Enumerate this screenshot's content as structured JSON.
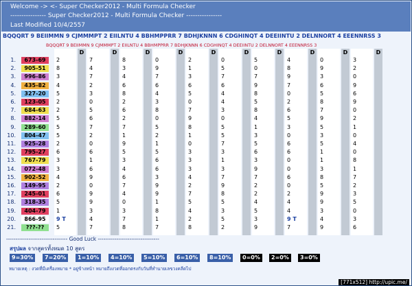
{
  "header": {
    "line1": "Welcome -> <- Super Checker2012 - Multi Formula Checker",
    "line2": "---------------- Super Checker2012 - Multi Formula Checker ----------------",
    "line3": "Last Modified 10/4/2557"
  },
  "formula_line": "BQQQRT 9 BEIIMMN 9 CJMMMPT 2 EIILNTU 4 BBHMPPRR 7 BDHJKNNN 6 CDGHINQT 4 DEEIINTU 2 DELNNORT 4 EEENNRSS 3",
  "formula_line_small": "BQQQRT 9 BEIIMMN 9 CJMMMPT 2 EIILNTU 4 BBHMPPRR 7 BDHJKNNN 6 CDGHINQT 4 DEEIINTU 2 DELNNORT 4 EEENNRSS 3",
  "d_label": "D",
  "rows": [
    {
      "n": "1.",
      "r": "673-69",
      "c": "#e04060",
      "v": [
        "2",
        "7",
        "8",
        "0",
        "2",
        "0",
        "5",
        "4",
        "0",
        "3"
      ]
    },
    {
      "n": "2.",
      "r": "905-51",
      "c": "#f0e050",
      "v": [
        "8",
        "4",
        "3",
        "9",
        "1",
        "5",
        "0",
        "8",
        "9",
        "2"
      ]
    },
    {
      "n": "3.",
      "r": "996-86",
      "c": "#d080d0",
      "v": [
        "3",
        "7",
        "4",
        "7",
        "3",
        "7",
        "7",
        "9",
        "3",
        "0"
      ]
    },
    {
      "n": "4.",
      "r": "435-82",
      "c": "#f0b040",
      "v": [
        "4",
        "2",
        "6",
        "6",
        "6",
        "6",
        "9",
        "7",
        "6",
        "9"
      ]
    },
    {
      "n": "5.",
      "r": "327-20",
      "c": "#80c0f0",
      "v": [
        "5",
        "3",
        "8",
        "4",
        "5",
        "4",
        "8",
        "0",
        "5",
        "6"
      ]
    },
    {
      "n": "6.",
      "r": "123-05",
      "c": "#e04060",
      "v": [
        "2",
        "0",
        "2",
        "3",
        "0",
        "4",
        "5",
        "2",
        "8",
        "9"
      ]
    },
    {
      "n": "7.",
      "r": "684-63",
      "c": "#f0e050",
      "v": [
        "2",
        "5",
        "6",
        "8",
        "7",
        "3",
        "8",
        "6",
        "7",
        "0"
      ]
    },
    {
      "n": "8.",
      "r": "882-14",
      "c": "#d080d0",
      "v": [
        "5",
        "6",
        "2",
        "0",
        "9",
        "0",
        "4",
        "5",
        "9",
        "2"
      ]
    },
    {
      "n": "9.",
      "r": "289-60",
      "c": "#90e090",
      "v": [
        "5",
        "7",
        "7",
        "5",
        "8",
        "5",
        "1",
        "3",
        "5",
        "1"
      ]
    },
    {
      "n": "10.",
      "r": "804-47",
      "c": "#80c0f0",
      "v": [
        "5",
        "2",
        "1",
        "2",
        "1",
        "5",
        "3",
        "0",
        "3",
        "0"
      ]
    },
    {
      "n": "11.",
      "r": "925-28",
      "c": "#b080e0",
      "v": [
        "2",
        "0",
        "9",
        "1",
        "0",
        "7",
        "5",
        "6",
        "5",
        "4"
      ]
    },
    {
      "n": "12.",
      "r": "795-27",
      "c": "#e04060",
      "v": [
        "6",
        "6",
        "5",
        "5",
        "3",
        "3",
        "6",
        "6",
        "1",
        "0"
      ]
    },
    {
      "n": "13.",
      "r": "767-79",
      "c": "#f0e050",
      "v": [
        "3",
        "1",
        "3",
        "6",
        "3",
        "1",
        "3",
        "0",
        "1",
        "8"
      ]
    },
    {
      "n": "14.",
      "r": "072-48",
      "c": "#d080d0",
      "v": [
        "3",
        "6",
        "4",
        "6",
        "3",
        "3",
        "9",
        "0",
        "3",
        "1"
      ]
    },
    {
      "n": "15.",
      "r": "902-52",
      "c": "#f0b040",
      "v": [
        "4",
        "9",
        "6",
        "3",
        "4",
        "7",
        "7",
        "6",
        "8",
        "7"
      ]
    },
    {
      "n": "16.",
      "r": "149-95",
      "c": "#b080e0",
      "v": [
        "2",
        "0",
        "7",
        "9",
        "2",
        "9",
        "2",
        "0",
        "5",
        "2"
      ]
    },
    {
      "n": "17.",
      "r": "245-01",
      "c": "#e04060",
      "v": [
        "6",
        "9",
        "4",
        "9",
        "7",
        "8",
        "2",
        "2",
        "9",
        "3"
      ]
    },
    {
      "n": "18.",
      "r": "318-35",
      "c": "#b080e0",
      "v": [
        "5",
        "9",
        "0",
        "1",
        "5",
        "5",
        "4",
        "4",
        "9",
        "5"
      ]
    },
    {
      "n": "19.",
      "r": "404-79",
      "c": "#e04060",
      "v": [
        "1",
        "3",
        "3",
        "8",
        "4",
        "3",
        "5",
        "4",
        "3",
        "0"
      ]
    },
    {
      "n": "20.",
      "r": "866-95",
      "c": "#ffffff",
      "v": [
        "9 T",
        "4",
        "7",
        "1",
        "2",
        "5",
        "3",
        "9 T",
        "4",
        "3"
      ]
    },
    {
      "n": "21.",
      "r": "???-??",
      "c": "#90e090",
      "v": [
        "5",
        "7",
        "8",
        "7",
        "8",
        "2",
        "9",
        "7",
        "9",
        "6"
      ]
    }
  ],
  "good_luck": "--------------------------------- Good Luck ---------------------------------",
  "summary": {
    "title_bold": "สรุปผล",
    "title_rest": " จากสูตรทั้งหมด 10 สูตร",
    "stats": [
      "9=30%",
      "7=20%",
      "1=10%",
      "4=10%",
      "5=10%",
      "6=10%",
      "8=10%",
      "0=0%",
      "2=0%",
      "3=0%"
    ],
    "note": "หมายเหตุ : งวดที่มีเครื่องหมาย * อยู่ข้างหน้า หมายถึงงวดที่ออกตรงกับวันที่ทำนายเลขวงคลีดไป"
  },
  "watermark": "[771x512] http://upic.me/"
}
